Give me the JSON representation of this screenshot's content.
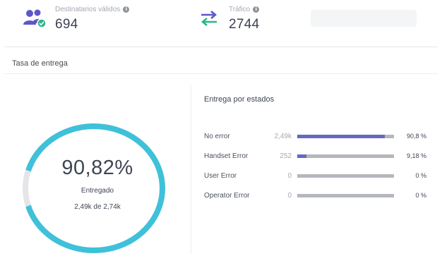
{
  "stats": {
    "recipients": {
      "label": "Destinatarios válidos",
      "value": "694",
      "icon": "users-check-icon"
    },
    "traffic": {
      "label": "Tráfico",
      "value": "2744",
      "icon": "swap-arrows-icon"
    }
  },
  "section_title": "Tasa de entrega",
  "delivery": {
    "percent_text": "90,82%",
    "label": "Entregado",
    "sub": "2,49k de 2,74k",
    "ratio": 0.9082
  },
  "states": {
    "title": "Entrega por estados",
    "rows": [
      {
        "name": "No error",
        "count": "2,49k",
        "pct": "90,8 %",
        "fraction": 0.908
      },
      {
        "name": "Handset Error",
        "count": "252",
        "pct": "9,18 %",
        "fraction": 0.0918
      },
      {
        "name": "User Error",
        "count": "0",
        "pct": "0 %",
        "fraction": 0
      },
      {
        "name": "Operator Error",
        "count": "0",
        "pct": "0 %",
        "fraction": 0
      }
    ]
  },
  "colors": {
    "donut_fill": "#3ec1d9",
    "donut_track": "#e3e5e8",
    "bar_fill": "#6269c4",
    "bar_track": "#b4b7bc",
    "icon_purple": "#5d57c9",
    "icon_green": "#2db58c"
  }
}
